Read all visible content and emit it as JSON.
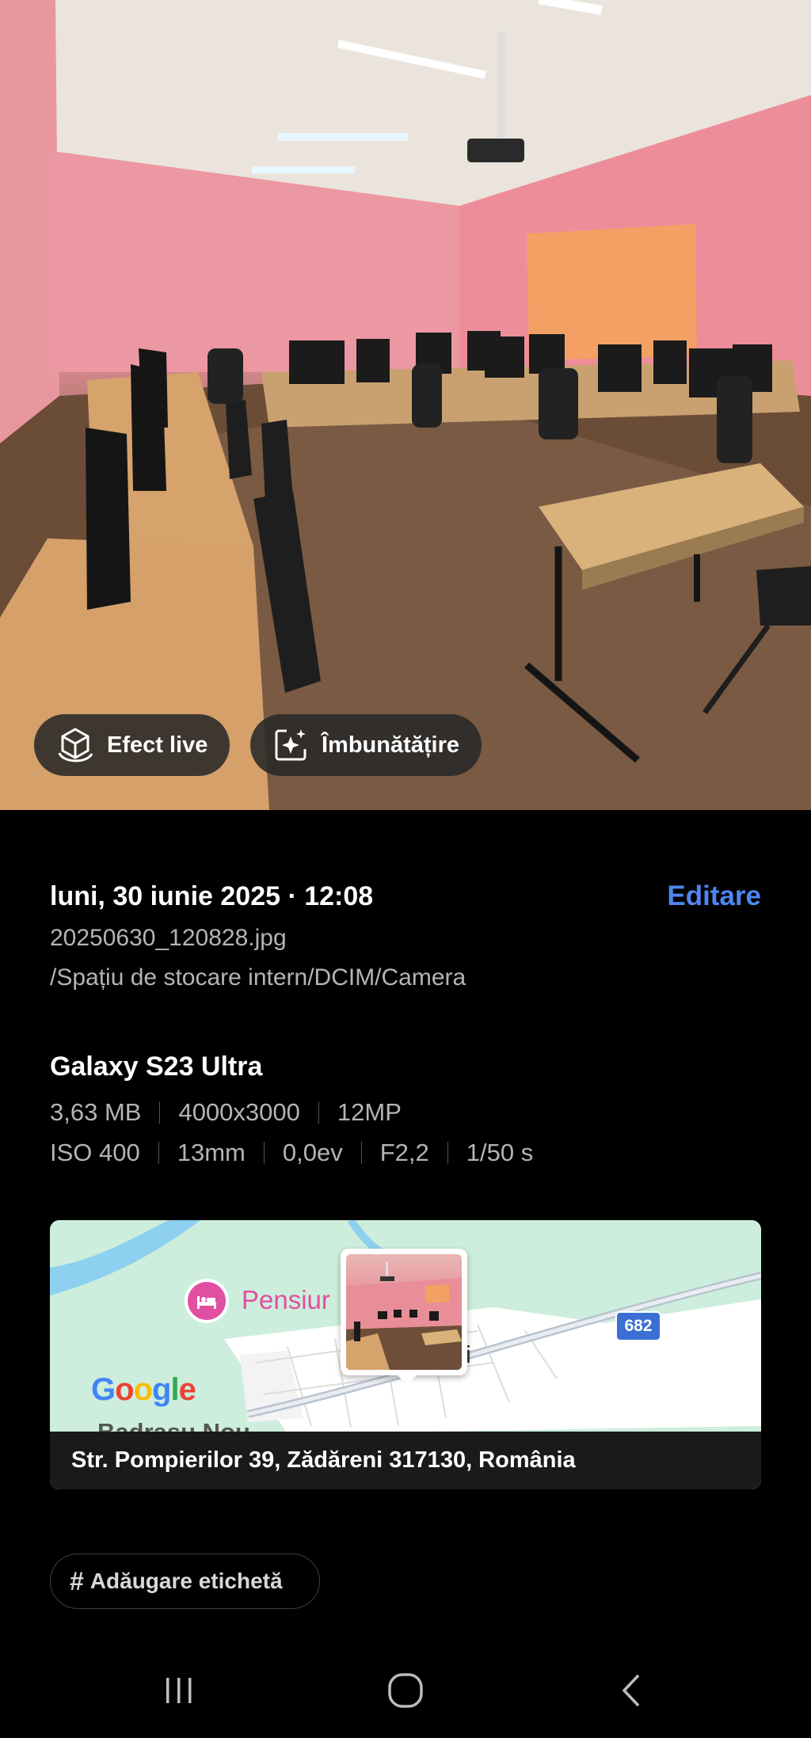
{
  "photo": {
    "chips": {
      "live_effect": "Efect live",
      "enhance": "Îmbunătățire"
    }
  },
  "details": {
    "date": "luni, 30 iunie 2025 · 12:08",
    "edit_label": "Editare",
    "filename": "20250630_120828.jpg",
    "path": "/Spațiu de stocare intern/DCIM/Camera",
    "device": "Galaxy S23 Ultra",
    "file_specs": [
      "3,63 MB",
      "4000x3000",
      "12MP"
    ],
    "camera_specs": [
      "ISO 400",
      "13mm",
      "0,0ev",
      "F2,2",
      "1/50 s"
    ]
  },
  "map": {
    "poi_label": "Pensiur",
    "road_number": "682",
    "logo": "Google",
    "place_partial": "Badrasu Nou",
    "place_fragment": "i",
    "address": "Str. Pompierilor 39, Zădăreni 317130, România"
  },
  "tag": {
    "label": "Adăugare etichetă"
  },
  "colors": {
    "accent": "#4f86f0",
    "poi_pink": "#e14fa2"
  },
  "navbar": {
    "icons": [
      "recent-apps-icon",
      "home-icon",
      "back-icon"
    ]
  }
}
